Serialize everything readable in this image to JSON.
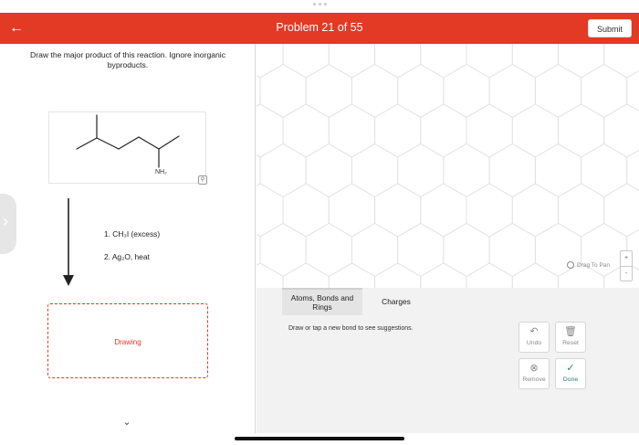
{
  "header": {
    "back_icon": "arrow-left-icon",
    "title": "Problem 21 of 55",
    "submit_label": "Submit",
    "accent_color": "#e23a25"
  },
  "question": {
    "prompt": "Draw the major product of this reaction. Ignore inorganic byproducts.",
    "substituent_label": "NH₂",
    "reagents": {
      "step1": "1. CH₃I (excess)",
      "step2": "2. Ag₂O, heat"
    },
    "answer_box_label": "Drawing"
  },
  "canvas": {
    "drag_pan_label": "Drag To Pan",
    "zoom_in": "+",
    "zoom_out": "-"
  },
  "toolbar": {
    "tabs": [
      {
        "label": "Atoms, Bonds and Rings"
      },
      {
        "label": "Charges"
      }
    ],
    "hint": "Draw or tap a new bond to see suggestions.",
    "buttons": {
      "undo": "Undo",
      "reset": "Reset",
      "remove": "Remove",
      "done": "Done"
    }
  }
}
